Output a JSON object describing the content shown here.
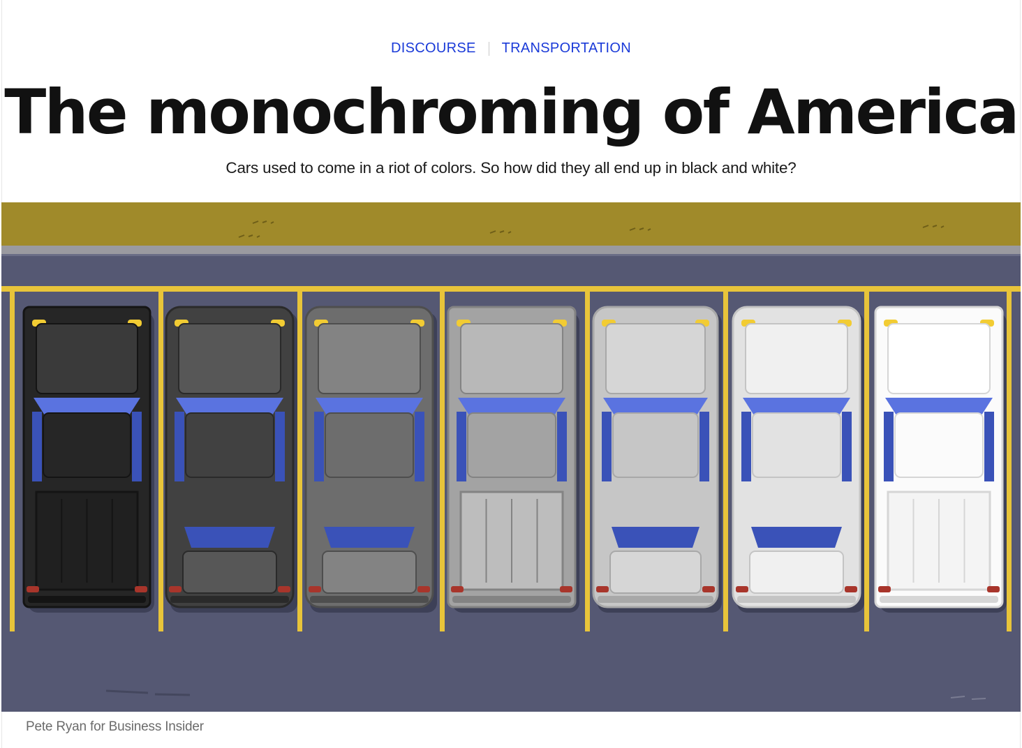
{
  "article": {
    "categories": [
      "DISCOURSE",
      "TRANSPORTATION"
    ],
    "title": "The monochroming of America",
    "dek": "Cars used to come in a riot of colors. So how did they all end up in black and white?",
    "image_credit": "Pete Ryan for Business Insider"
  },
  "illustration": {
    "cars": [
      {
        "type": "pickup",
        "body": "#262626",
        "shade": "#141414",
        "light": "#3a3a3a",
        "bed": "#202020"
      },
      {
        "type": "sedan",
        "body": "#414141",
        "shade": "#2a2a2a",
        "light": "#575757",
        "bed": "#3a3a3a"
      },
      {
        "type": "suv",
        "body": "#6d6d6d",
        "shade": "#4e4e4e",
        "light": "#838383",
        "bed": "#6d6d6d"
      },
      {
        "type": "pickup",
        "body": "#a3a3a3",
        "shade": "#838383",
        "light": "#b8b8b8",
        "bed": "#bdbdbd"
      },
      {
        "type": "sedan",
        "body": "#c6c6c6",
        "shade": "#a8a8a8",
        "light": "#d6d6d6",
        "bed": "#c6c6c6"
      },
      {
        "type": "suv",
        "body": "#e2e2e2",
        "shade": "#c4c4c4",
        "light": "#f0f0f0",
        "bed": "#e2e2e2"
      },
      {
        "type": "pickup",
        "body": "#fbfbfb",
        "shade": "#d6d6d6",
        "light": "#ffffff",
        "bed": "#f4f4f4"
      }
    ],
    "colors": {
      "grass": "#a08a2a",
      "curb": "#9a9aa0",
      "asphalt": "#555873",
      "parking_line": "#e8c43a",
      "glass": "#5a73e0",
      "glass_dark": "#3a52b8",
      "headlight": "#f2cc33",
      "taillight": "#a8352b"
    }
  }
}
